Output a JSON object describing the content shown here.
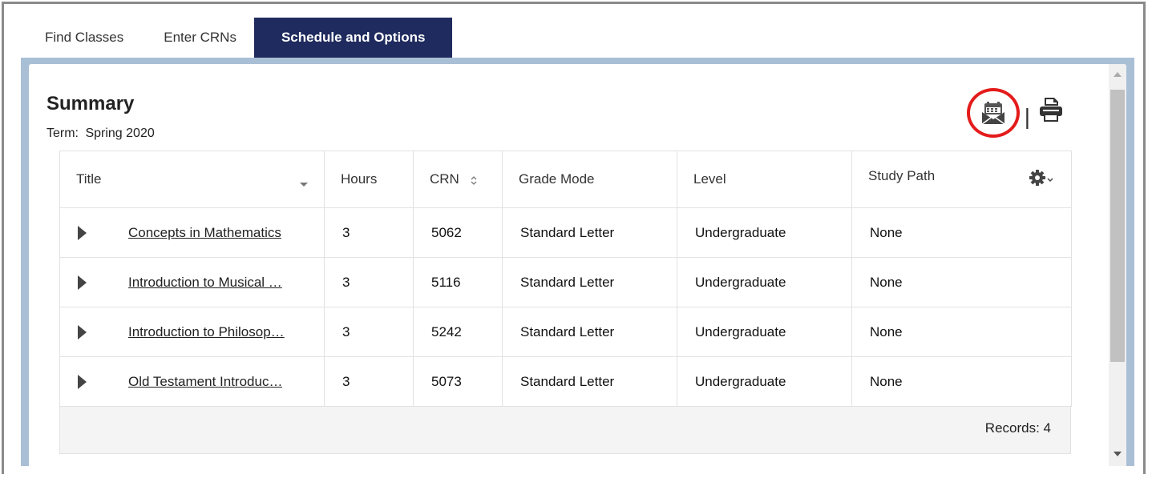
{
  "tabs": [
    {
      "label": "Find Classes"
    },
    {
      "label": "Enter CRNs"
    },
    {
      "label": "Schedule and Options"
    }
  ],
  "summary": {
    "title": "Summary",
    "term_label": "Term:",
    "term_value": "Spring 2020"
  },
  "toolbar": {
    "email_calendar_icon": "calendar-email-icon",
    "separator": "|",
    "print_icon": "printer-icon"
  },
  "table": {
    "columns": [
      "Title",
      "Hours",
      "CRN",
      "Grade Mode",
      "Level",
      "Study Path"
    ],
    "settings_icon": "gear-icon",
    "rows": [
      {
        "title": "Concepts in Mathematics",
        "hours": "3",
        "crn": "5062",
        "grade_mode": "Standard Letter",
        "level": "Undergraduate",
        "study_path": "None"
      },
      {
        "title": "Introduction to Musical …",
        "hours": "3",
        "crn": "5116",
        "grade_mode": "Standard Letter",
        "level": "Undergraduate",
        "study_path": "None"
      },
      {
        "title": "Introduction to Philosop…",
        "hours": "3",
        "crn": "5242",
        "grade_mode": "Standard Letter",
        "level": "Undergraduate",
        "study_path": "None"
      },
      {
        "title": "Old Testament Introduc…",
        "hours": "3",
        "crn": "5073",
        "grade_mode": "Standard Letter",
        "level": "Undergraduate",
        "study_path": "None"
      }
    ],
    "records": "Records: 4"
  },
  "colors": {
    "active_tab": "#1f2b5e",
    "panel_border": "#a9bfd6",
    "highlight_circle": "#e41b1b"
  }
}
